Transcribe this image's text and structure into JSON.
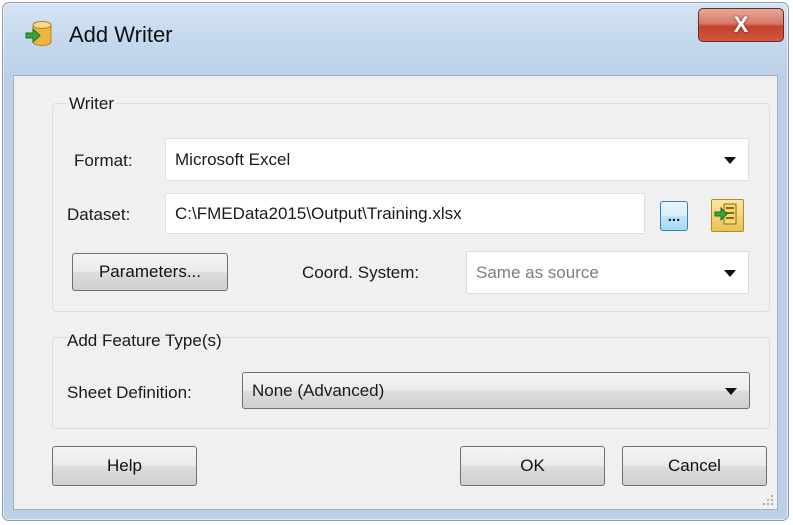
{
  "window": {
    "title": "Add Writer",
    "close_symbol": "X"
  },
  "writer_group": {
    "title": "Writer",
    "format_label": "Format:",
    "format_value": "Microsoft Excel",
    "dataset_label": "Dataset:",
    "dataset_value": "C:\\FMEData2015\\Output\\Training.xlsx",
    "browse_label": "...",
    "parameters_label": "Parameters...",
    "coord_label": "Coord. System:",
    "coord_value": "Same as source"
  },
  "feature_group": {
    "title": "Add Feature Type(s)",
    "sheet_label": "Sheet Definition:",
    "sheet_value": "None (Advanced)"
  },
  "buttons": {
    "help": "Help",
    "ok": "OK",
    "cancel": "Cancel"
  },
  "icons": {
    "app": "database-add-icon",
    "close": "close-icon",
    "dropdown": "chevron-down-icon",
    "parameters": "dataset-parameters-icon",
    "resize": "resize-grip-icon"
  },
  "colors": {
    "title_bar": "#c6d9ee",
    "close_button": "#c4432d",
    "client_background": "#f0f0f0",
    "browse_button": "#bee6fd"
  }
}
